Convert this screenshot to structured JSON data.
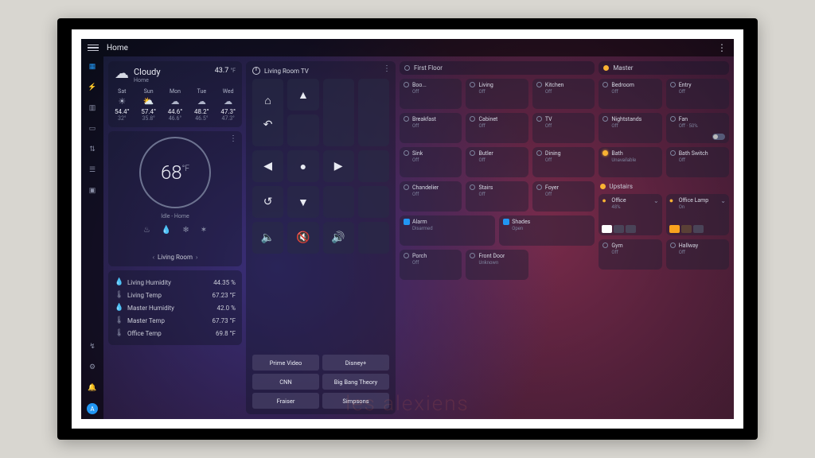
{
  "header": {
    "title": "Home"
  },
  "weather": {
    "condition": "Cloudy",
    "location": "Home",
    "temp": "43.7",
    "unit": "°F",
    "forecast": [
      {
        "day": "Sat",
        "icon": "☀",
        "hi": "54.4°",
        "lo": "32°"
      },
      {
        "day": "Sun",
        "icon": "⛅",
        "hi": "57.4°",
        "lo": "35.8°"
      },
      {
        "day": "Mon",
        "icon": "☁",
        "hi": "44.6°",
        "lo": "46.6°"
      },
      {
        "day": "Tue",
        "icon": "☁",
        "hi": "48.2°",
        "lo": "46.5°"
      },
      {
        "day": "Wed",
        "icon": "☁",
        "hi": "47.3°",
        "lo": "47.3°"
      }
    ]
  },
  "thermostat": {
    "temp": "68",
    "unit": "°F",
    "status": "Idle - Home",
    "room": "Living Room"
  },
  "sensors": [
    {
      "icon": "💧",
      "name": "Living Humidity",
      "value": "44.35 %"
    },
    {
      "icon": "🌡",
      "name": "Living Temp",
      "value": "67.23 °F"
    },
    {
      "icon": "💧",
      "name": "Master Humidity",
      "value": "42.0 %"
    },
    {
      "icon": "🌡",
      "name": "Master Temp",
      "value": "67.73 °F"
    },
    {
      "icon": "🌡",
      "name": "Office Temp",
      "value": "69.8 °F"
    }
  ],
  "remote": {
    "title": "Living Room TV",
    "shortcuts": [
      "Prime Video",
      "Disney+",
      "CNN",
      "Big Bang Theory",
      "Fraiser",
      "Simpsons"
    ]
  },
  "zones": {
    "first": {
      "label": "First Floor",
      "tiles": [
        {
          "name": "Boo...",
          "state": "Off",
          "on": false
        },
        {
          "name": "Living",
          "state": "Off",
          "on": false
        },
        {
          "name": "Kitchen",
          "state": "Off",
          "on": false
        },
        {
          "name": "Breakfast",
          "state": "Off",
          "on": false
        },
        {
          "name": "Cabinet",
          "state": "Off",
          "on": false
        },
        {
          "name": "TV",
          "state": "Off",
          "on": false
        },
        {
          "name": "Sink",
          "state": "Off",
          "on": false
        },
        {
          "name": "Butler",
          "state": "Off",
          "on": false
        },
        {
          "name": "Dining",
          "state": "Off",
          "on": false
        },
        {
          "name": "Chandelier",
          "state": "Off",
          "on": false
        },
        {
          "name": "Stairs",
          "state": "Off",
          "on": false
        },
        {
          "name": "Foyer",
          "state": "Off",
          "on": false
        },
        {
          "name": "Porch",
          "state": "Off",
          "on": false
        },
        {
          "name": "Front Door",
          "state": "Unknown",
          "on": false
        }
      ],
      "alarm": {
        "name": "Alarm",
        "state": "Disarmed"
      },
      "shades": {
        "name": "Shades",
        "state": "Open"
      }
    },
    "master": {
      "label": "Master",
      "tiles": [
        {
          "name": "Bedroom",
          "state": "Off",
          "on": false
        },
        {
          "name": "Entry",
          "state": "Off",
          "on": false
        },
        {
          "name": "Nightstands",
          "state": "Off",
          "on": false
        },
        {
          "name": "Fan",
          "state": "Off · 50%",
          "on": false,
          "toggle": true
        },
        {
          "name": "Bath",
          "state": "Unavailable",
          "on": true
        },
        {
          "name": "Bath Switch",
          "state": "Off",
          "on": false
        }
      ]
    },
    "upstairs": {
      "label": "Upstairs",
      "office": {
        "name": "Office",
        "state": "48%",
        "on": true,
        "colors": [
          "#ffffff",
          "#4a4458",
          "#4a4458"
        ]
      },
      "lamp": {
        "name": "Office Lamp",
        "state": "On",
        "on": true,
        "colors": [
          "#f9a21e",
          "#5a4036",
          "#4a4458"
        ]
      },
      "tiles": [
        {
          "name": "Gym",
          "state": "Off",
          "on": false
        },
        {
          "name": "Hallway",
          "state": "Off",
          "on": false
        }
      ]
    }
  },
  "watermark": "les alexiens"
}
